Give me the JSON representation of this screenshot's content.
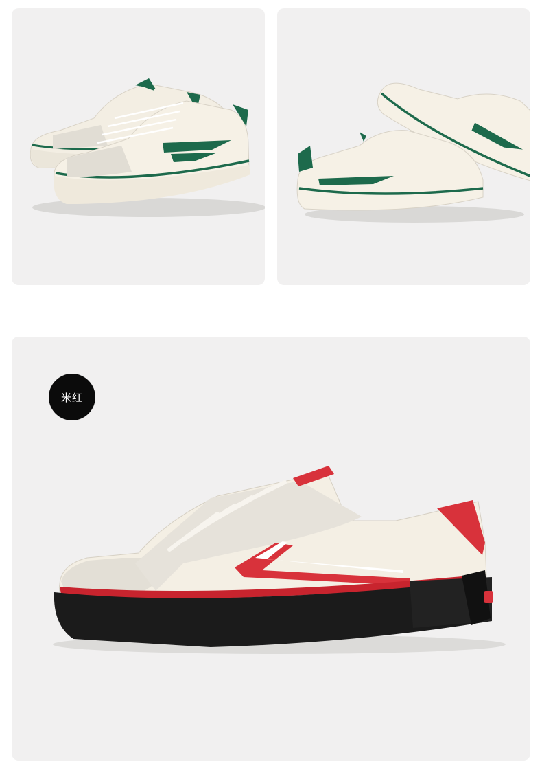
{
  "gallery": {
    "top_left": {
      "image": "green-trim-sneaker-pair-side-view"
    },
    "top_right": {
      "image": "green-trim-sneaker-pair-heel-view"
    },
    "main": {
      "image": "red-trim-black-sole-sneaker-side-view",
      "color_label": "米红"
    }
  },
  "colors": {
    "card_bg": "#f1f0f0",
    "canvas_cream": "#f3eee3",
    "suede_grey": "#e1ddd4",
    "trim_green": "#1d6a4c",
    "trim_red": "#d8323b",
    "sole_black": "#1b1b1b",
    "badge_bg": "#0b0b0b"
  }
}
